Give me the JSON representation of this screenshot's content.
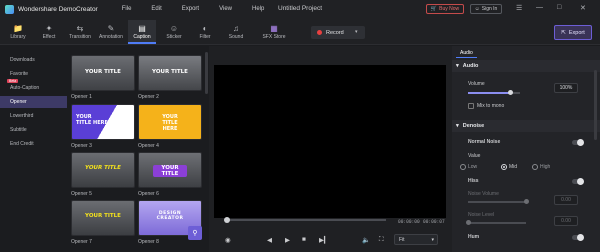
{
  "titlebar": {
    "app_name": "Wondershare DemoCreator",
    "menu": [
      "File",
      "Edit",
      "Export",
      "View",
      "Help"
    ],
    "project_title": "Untitled Project",
    "buy_label": "Buy Now",
    "signin_label": "Sign In"
  },
  "toolbar": {
    "tools": [
      {
        "label": "Library",
        "icon": "folder-icon"
      },
      {
        "label": "Effect",
        "icon": "effect-icon"
      },
      {
        "label": "Transition",
        "icon": "transition-icon"
      },
      {
        "label": "Annotation",
        "icon": "annotation-icon"
      },
      {
        "label": "Caption",
        "icon": "caption-icon"
      },
      {
        "label": "Sticker",
        "icon": "sticker-icon"
      },
      {
        "label": "Filter",
        "icon": "filter-icon"
      },
      {
        "label": "Sound",
        "icon": "sound-icon"
      },
      {
        "label": "SFX Store",
        "icon": "store-icon"
      }
    ],
    "active_tool": "Caption",
    "record_label": "Record",
    "export_label": "Export"
  },
  "sidebar": {
    "categories": [
      "Downloads",
      "Favorite",
      "Auto-Caption",
      "Opener",
      "Lowerthird",
      "Subtitle",
      "End Credit"
    ],
    "active": "Opener",
    "beta_badge": "Beta"
  },
  "templates": [
    {
      "name": "Opener 1",
      "thumb_text": "YOUR TITLE",
      "bg": "#5b5d62",
      "accent": "#ffffff"
    },
    {
      "name": "Opener 2",
      "thumb_text": "YOUR TITLE",
      "bg": "#6a6c70",
      "accent": "#ffffff"
    },
    {
      "name": "Opener 3",
      "thumb_text": "YOUR TITLE HERE",
      "bg": "#5a3fd6",
      "accent": "#ffffff"
    },
    {
      "name": "Opener 4",
      "thumb_text": "YOUR TITLE HERE",
      "bg": "#f5b21a",
      "accent": "#ffffff"
    },
    {
      "name": "Opener 5",
      "thumb_text": "YOUR TITLE",
      "bg": "#55575c",
      "accent": "#f4e21c"
    },
    {
      "name": "Opener 6",
      "thumb_text": "YOUR TITLE",
      "bg": "#5c5e63",
      "accent": "#ffffff"
    },
    {
      "name": "Opener 7",
      "thumb_text": "YOUR TITLE",
      "bg": "#585a5f",
      "accent": "#f4e21c"
    },
    {
      "name": "Opener 8",
      "thumb_text": "DESIGN CREATOR",
      "bg": "#9a86e8",
      "accent": "#ffffff"
    }
  ],
  "player": {
    "current_time": "00:00:00",
    "total_time": "00:00:07",
    "fit_label": "Fit"
  },
  "panel": {
    "tab_label": "Audio",
    "audio_section": "Audio",
    "volume_label": "Volume",
    "volume_value": "100%",
    "volume_level": 0.8,
    "mix_mono_label": "Mix to mono",
    "denoise_section": "Denoise",
    "normal_noise_label": "Normal Noise",
    "value_label": "Value",
    "radio_options": [
      "Low",
      "Mid",
      "High"
    ],
    "radio_selected": "Mid",
    "hiss_label": "Hiss",
    "noise_volume_label": "Noise Volume",
    "noise_volume_value": "0.00",
    "noise_level_label": "Noise Level",
    "noise_level_value": "0.00",
    "hum_label": "Hum"
  },
  "colors": {
    "accent": "#4f7cf6",
    "active_category": "#3d3a66",
    "export_border": "#6d5ed6",
    "record_dot": "#e84040"
  }
}
